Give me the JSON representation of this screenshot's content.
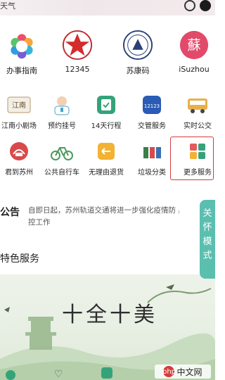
{
  "status_bar": {
    "left_text": "天气"
  },
  "row1": [
    {
      "label": "办事指南",
      "icon": "colorful-ring-logo-icon"
    },
    {
      "label": "12345",
      "icon": "red-star-emblem-icon"
    },
    {
      "label": "苏康码",
      "icon": "round-seal-icon"
    },
    {
      "label": "iSuzhou",
      "icon": "su-character-icon"
    }
  ],
  "row2": [
    {
      "label": "江南小剧场",
      "icon": "theater-icon"
    },
    {
      "label": "预约挂号",
      "icon": "doctor-icon"
    },
    {
      "label": "14天行程",
      "icon": "itinerary-icon"
    },
    {
      "label": "交管服务",
      "icon": "traffic-12123-icon"
    },
    {
      "label": "实时公交",
      "icon": "bus-icon"
    }
  ],
  "row3": [
    {
      "label": "君到苏州",
      "icon": "suzhou-tour-icon"
    },
    {
      "label": "公共自行车",
      "icon": "bicycle-icon"
    },
    {
      "label": "无理由退货",
      "icon": "return-goods-icon"
    },
    {
      "label": "垃圾分类",
      "icon": "garbage-sort-icon"
    },
    {
      "label": "更多服务",
      "icon": "more-services-grid-icon"
    }
  ],
  "notice": {
    "title": "公告",
    "text": "自即日起，苏州轨道交通将进一步强化疫情防控工作"
  },
  "section": {
    "title": "特色服务"
  },
  "banner": {
    "title": "十全十美"
  },
  "side_card": {
    "chars": [
      "关",
      "怀",
      "模",
      "式"
    ]
  },
  "watermark": {
    "text": "中文网"
  },
  "colors": {
    "accent_green": "#35a37a",
    "highlight_red": "#d43b3b",
    "side_teal": "#5bbfb0"
  }
}
